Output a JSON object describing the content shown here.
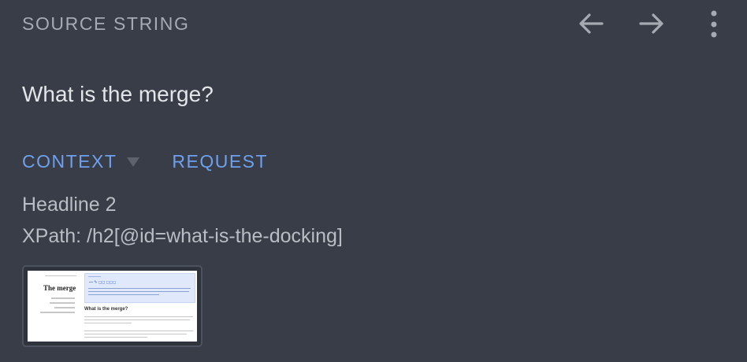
{
  "header": {
    "label": "SOURCE STRING",
    "back_icon": "arrow-left-icon",
    "forward_icon": "arrow-right-icon",
    "more_icon": "more-vertical-icon"
  },
  "source": {
    "text": "What is the merge?"
  },
  "tabs": {
    "context_label": "CONTEXT",
    "request_label": "REQUEST"
  },
  "context": {
    "element_type": "Headline 2",
    "xpath": "XPath: /h2[@id=what-is-the-docking]"
  },
  "screenshot": {
    "page_title": "The merge",
    "section_heading": "What is the merge?"
  },
  "colors": {
    "background": "#383d47",
    "accent": "#6ea0ee"
  }
}
